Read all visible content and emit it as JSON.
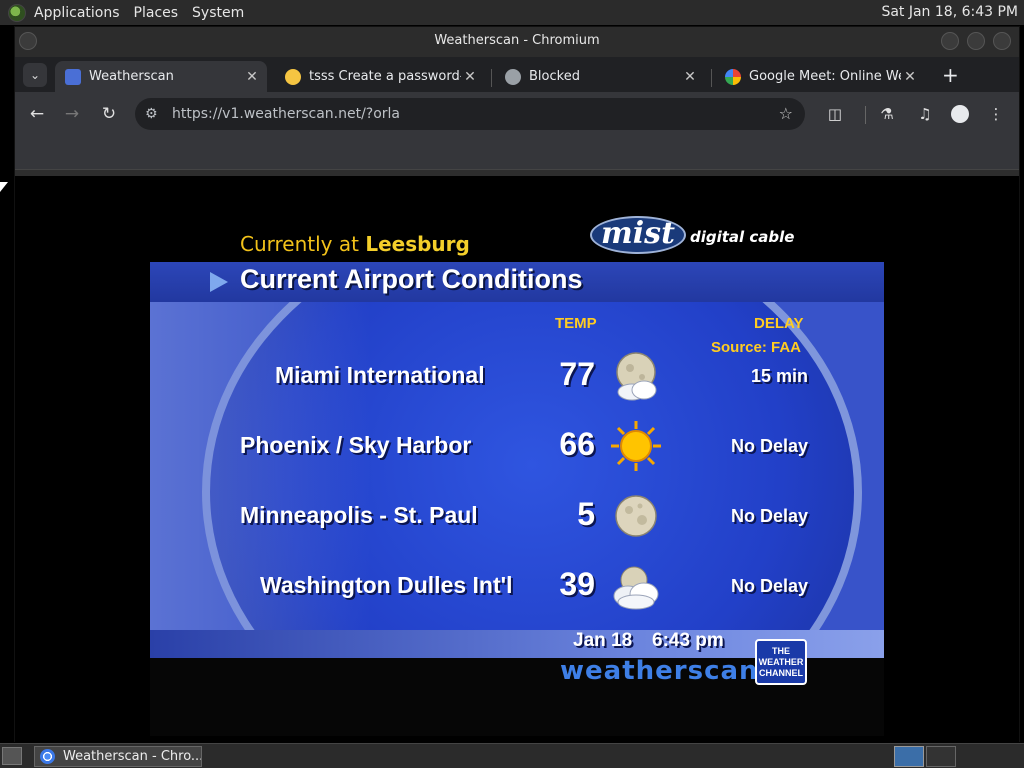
{
  "top_panel": {
    "menus": [
      "Applications",
      "Places",
      "System"
    ],
    "clock": "Sat Jan 18,  6:43 PM"
  },
  "window": {
    "title": "Weatherscan - Chromium"
  },
  "tabs": [
    {
      "label": "Weatherscan",
      "favicon_color": "#4a6fd6",
      "active": true
    },
    {
      "label": "tsss Create a password-p",
      "favicon_color": "#f5c542",
      "active": false
    },
    {
      "label": "Blocked",
      "favicon_color": "#9aa0a6",
      "active": false
    },
    {
      "label": "Google Meet: Online Web",
      "favicon_color": "#ffffff",
      "active": false
    }
  ],
  "toolbar": {
    "url": "https://v1.weatherscan.net/?orla"
  },
  "weatherscan": {
    "currently_prefix": "Currently at",
    "location": "Leesburg",
    "sponsor_logo": "mist",
    "sponsor_sub": "digital cable",
    "section_title": "Current Airport Conditions",
    "col_temp": "TEMP",
    "col_delay": "DELAY",
    "source": "Source: FAA",
    "rows": [
      {
        "airport": "Miami International",
        "temp": "77",
        "icon": "partly-cloudy-night-icon",
        "delay": "15 min"
      },
      {
        "airport": "Phoenix / Sky Harbor",
        "temp": "66",
        "icon": "sunny-icon",
        "delay": "No Delay"
      },
      {
        "airport": "Minneapolis - St. Paul",
        "temp": "5",
        "icon": "clear-moon-icon",
        "delay": "No Delay"
      },
      {
        "airport": "Washington Dulles Int'l",
        "temp": "39",
        "icon": "cloudy-icon",
        "delay": "No Delay"
      }
    ],
    "date": "Jan 18",
    "time": "6:43 pm",
    "brand": "weatherscan",
    "twc_logo": "THE WEATHER CHANNEL"
  },
  "taskbar": {
    "task_label": "Weatherscan - Chro..."
  }
}
